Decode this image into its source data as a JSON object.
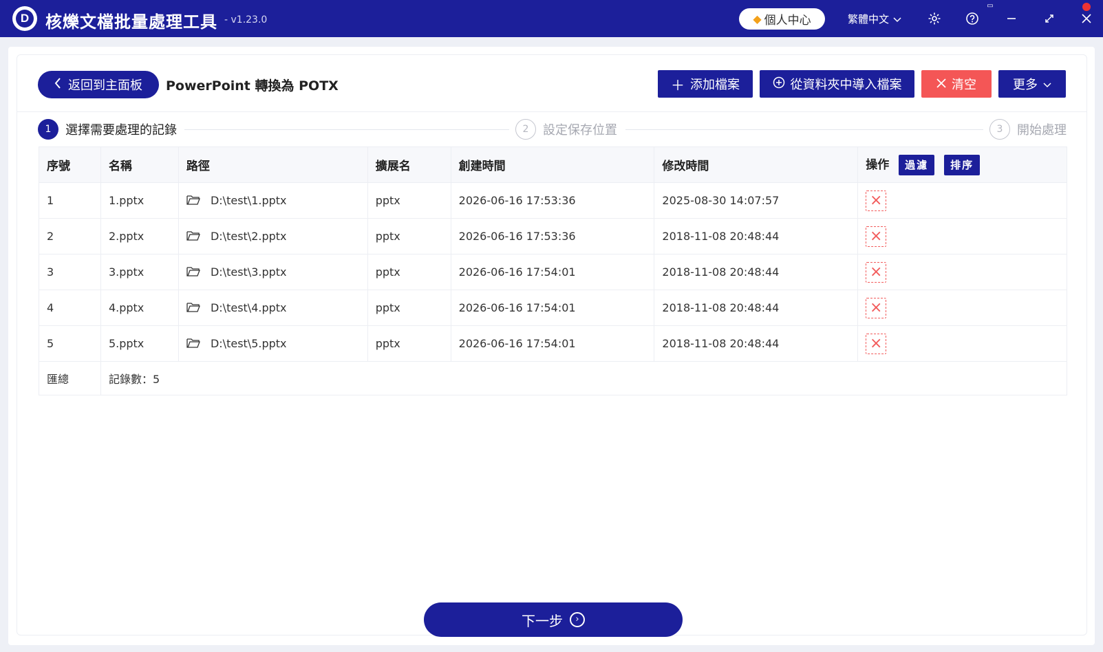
{
  "app": {
    "logo_letter": "D",
    "title": "核爍文檔批量處理工具",
    "version": "- v1.23.0",
    "user_center": "個人中心",
    "language": "繁體中文"
  },
  "toolbar": {
    "back_label": "返回到主面板",
    "page_title": "PowerPoint 轉換為 POTX",
    "add_file": "添加檔案",
    "import_folder": "從資料夾中導入檔案",
    "clear": "清空",
    "more": "更多"
  },
  "steps": [
    {
      "num": "1",
      "label": "選擇需要處理的記錄"
    },
    {
      "num": "2",
      "label": "設定保存位置"
    },
    {
      "num": "3",
      "label": "開始處理"
    }
  ],
  "table": {
    "headers": [
      "序號",
      "名稱",
      "路徑",
      "擴展名",
      "創建時間",
      "修改時間",
      "操作"
    ],
    "filter_label": "過濾",
    "sort_label": "排序",
    "rows": [
      {
        "idx": "1",
        "name": "1.pptx",
        "path": "D:\\test\\1.pptx",
        "ext": "pptx",
        "created": "2026-06-16 17:53:36",
        "modified": "2025-08-30 14:07:57"
      },
      {
        "idx": "2",
        "name": "2.pptx",
        "path": "D:\\test\\2.pptx",
        "ext": "pptx",
        "created": "2026-06-16 17:53:36",
        "modified": "2018-11-08 20:48:44"
      },
      {
        "idx": "3",
        "name": "3.pptx",
        "path": "D:\\test\\3.pptx",
        "ext": "pptx",
        "created": "2026-06-16 17:54:01",
        "modified": "2018-11-08 20:48:44"
      },
      {
        "idx": "4",
        "name": "4.pptx",
        "path": "D:\\test\\4.pptx",
        "ext": "pptx",
        "created": "2026-06-16 17:54:01",
        "modified": "2018-11-08 20:48:44"
      },
      {
        "idx": "5",
        "name": "5.pptx",
        "path": "D:\\test\\5.pptx",
        "ext": "pptx",
        "created": "2026-06-16 17:54:01",
        "modified": "2018-11-08 20:48:44"
      }
    ],
    "summary_label": "匯總",
    "summary_count": "記錄數：5"
  },
  "footer": {
    "next_label": "下一步"
  },
  "icons": {
    "gem": "gem-icon",
    "gear": "gear-icon",
    "help": "help-icon",
    "minimize": "minimize-icon",
    "maximize": "maximize-icon",
    "close": "close-icon",
    "folder": "folder-icon",
    "delete": "delete-icon"
  },
  "colors": {
    "primary": "#1c1f9a",
    "danger": "#f45656",
    "background": "#eef0f6"
  }
}
